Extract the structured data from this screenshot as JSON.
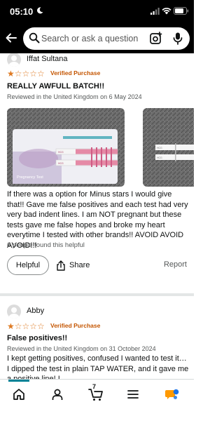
{
  "status_bar": {
    "time": "05:10"
  },
  "search": {
    "placeholder": "Search or ask a question"
  },
  "reviews": [
    {
      "reviewer": "Iffat Sultana",
      "rating": 1,
      "max_rating": 5,
      "verified": "Verified Purchase",
      "title": "REALLY AWFULL BATCH!!",
      "meta": "Reviewed in the United Kingdom on 6 May 2024",
      "photo_labels": {
        "box": "Pregnancy Test",
        "strip": "HCG"
      },
      "body": "If there was a option for Minus stars I would give that!! Gave me false positives and each test had very very bad indent lines. I am NOT pregnant but these tests gave me false hopes and broke my heart everytime I tested with other brands!! AVOID AVOID AVOID!!!",
      "helpful_count": "6 people found this helpful",
      "helpful_label": "Helpful",
      "share_label": "Share",
      "report_label": "Report"
    },
    {
      "reviewer": "Abby",
      "rating": 1,
      "max_rating": 5,
      "verified": "Verified Purchase",
      "title": "False positives!!",
      "meta": "Reviewed in the United Kingdom on 31 October 2024",
      "body": "I kept getting positives, confused I wanted to test it… I dipped the test in plain TAP WATER, and it gave me a positive line! I"
    }
  ],
  "bottom_nav": {
    "cart_count": "7",
    "active": "home",
    "accent_color": "#008296"
  },
  "colors": {
    "star": "#de7921",
    "verified": "#c45500"
  }
}
